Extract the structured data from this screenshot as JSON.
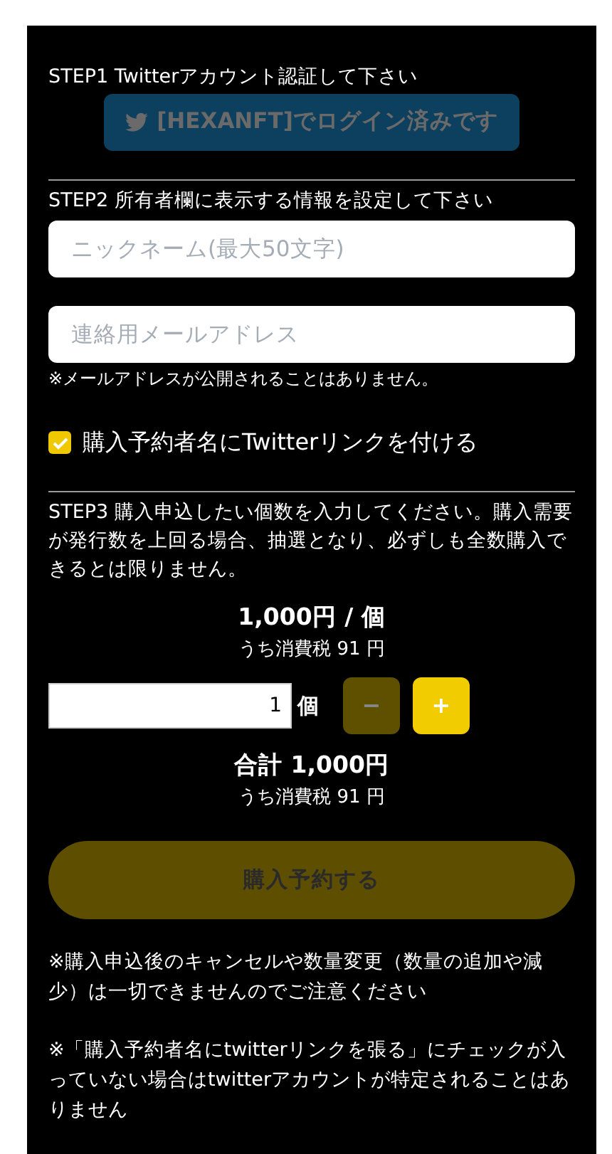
{
  "step1": {
    "label": "STEP1 Twitterアカウント認証して下さい",
    "login_button": {
      "label": "[HEXANFT]でログイン済みです",
      "disabled": true
    }
  },
  "step2": {
    "label": "STEP2 所有者欄に表示する情報を設定して下さい",
    "nickname": {
      "placeholder": "ニックネーム(最大50文字)"
    },
    "email": {
      "placeholder": "連絡用メールアドレス"
    },
    "email_note": "※メールアドレスが公開されることはありません。",
    "twitter_link": {
      "label": "購入予約者名にTwitterリンクを付ける",
      "checked": true
    }
  },
  "step3": {
    "label": "STEP3 購入申込したい個数を入力してください。購入需要が発行数を上回る場合、抽選となり、必ずしも全数購入できるとは限りません。",
    "unit_price": "1,000円 / 個",
    "unit_tax": "うち消費税 91 円",
    "quantity": {
      "value": "1",
      "unit": "個"
    },
    "minus_button": {
      "label": "−",
      "disabled": true
    },
    "plus_button": {
      "label": "+",
      "disabled": false
    },
    "total": "合計 1,000円",
    "total_tax": "うち消費税 91 円"
  },
  "reserve_button": {
    "label": "購入予約する",
    "disabled": true
  },
  "notes": [
    "※購入申込後のキャンセルや数量変更（数量の追加や減少）は一切できませんのでご注意ください",
    "※「購入予約者名にtwitterリンクを張る」にチェックが入っていない場合はtwitterアカウントが特定されることはありません"
  ]
}
